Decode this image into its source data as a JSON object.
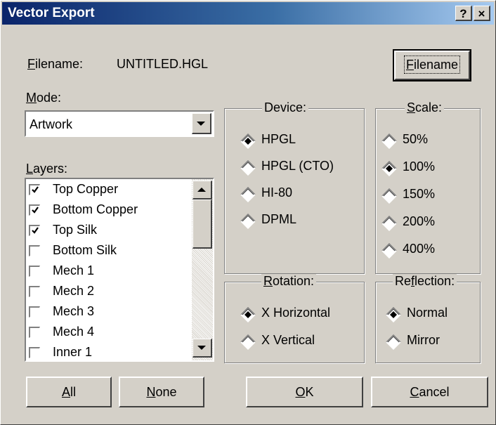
{
  "window": {
    "title": "Vector Export",
    "help_icon": "?",
    "close_icon": "×"
  },
  "filename": {
    "label_u": "F",
    "label_rest": "ilename:",
    "value": "UNTITLED.HGL",
    "button_u": "F",
    "button_rest": "ilename"
  },
  "mode": {
    "label_u": "M",
    "label_rest": "ode:",
    "selected": "Artwork",
    "dropdown_icon": "chevron-down-icon"
  },
  "layers": {
    "label_u": "L",
    "label_rest": "ayers:",
    "items": [
      {
        "label": "Top Copper",
        "checked": true
      },
      {
        "label": "Bottom Copper",
        "checked": true
      },
      {
        "label": "Top Silk",
        "checked": true
      },
      {
        "label": "Bottom Silk",
        "checked": false
      },
      {
        "label": "Mech 1",
        "checked": false
      },
      {
        "label": "Mech 2",
        "checked": false
      },
      {
        "label": "Mech 3",
        "checked": false
      },
      {
        "label": "Mech 4",
        "checked": false
      },
      {
        "label": "Inner 1",
        "checked": false
      }
    ]
  },
  "device": {
    "title": "Device:",
    "options": [
      {
        "label": "HPGL",
        "selected": true
      },
      {
        "label": "HPGL (CTO)",
        "selected": false
      },
      {
        "label": "HI-80",
        "selected": false
      },
      {
        "label": "DPML",
        "selected": false
      }
    ]
  },
  "scale": {
    "title_u": "S",
    "title_rest": "cale:",
    "options": [
      {
        "label": "50%",
        "selected": false
      },
      {
        "label": "100%",
        "selected": true
      },
      {
        "label": "150%",
        "selected": false
      },
      {
        "label": "200%",
        "selected": false
      },
      {
        "label": "400%",
        "selected": false
      }
    ]
  },
  "rotation": {
    "title_u": "R",
    "title_rest": "otation:",
    "options": [
      {
        "label": "X Horizontal",
        "selected": true
      },
      {
        "label": "X Vertical",
        "selected": false
      }
    ]
  },
  "reflection": {
    "title_pre": "Re",
    "title_u": "f",
    "title_rest": "lection:",
    "options": [
      {
        "label": "Normal",
        "selected": true
      },
      {
        "label": "Mirror",
        "selected": false
      }
    ]
  },
  "buttons": {
    "all_u": "A",
    "all_rest": "ll",
    "none_u": "N",
    "none_rest": "one",
    "ok_u": "O",
    "ok_rest": "K",
    "cancel_u": "C",
    "cancel_rest": "ancel"
  }
}
